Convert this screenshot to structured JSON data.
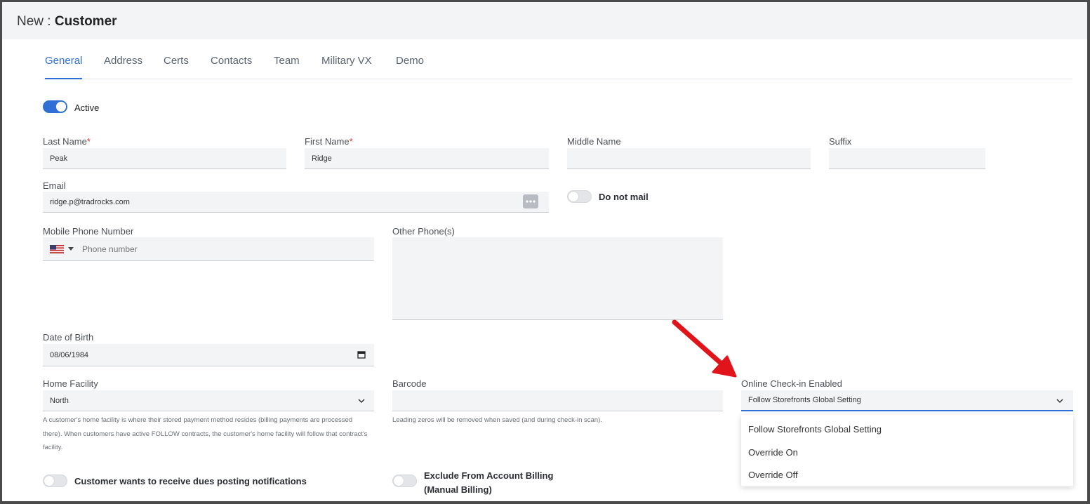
{
  "header": {
    "prefix": "New :",
    "title": "Customer"
  },
  "tabs": [
    "General",
    "Address",
    "Certs",
    "Contacts",
    "Team",
    "Military VX",
    "Demo"
  ],
  "active_toggle": {
    "label": "Active",
    "on": true
  },
  "fields": {
    "last_name": {
      "label": "Last Name",
      "required_mark": "*",
      "value": "Peak"
    },
    "first_name": {
      "label": "First Name",
      "required_mark": "*",
      "value": "Ridge"
    },
    "middle_name": {
      "label": "Middle Name",
      "value": ""
    },
    "suffix": {
      "label": "Suffix",
      "value": ""
    },
    "email": {
      "label": "Email",
      "value": "ridge.p@tradrocks.com"
    },
    "do_not_mail": {
      "label": "Do not mail",
      "on": false
    },
    "mobile_phone": {
      "label": "Mobile Phone Number",
      "placeholder": "Phone number"
    },
    "other_phones": {
      "label": "Other Phone(s)",
      "value": ""
    },
    "dob": {
      "label": "Date of Birth",
      "value": "08/06/1984"
    },
    "home_facility": {
      "label": "Home Facility",
      "value": "North",
      "help": "A customer's home facility is where their stored payment method resides (billing payments are processed there). When customers have active FOLLOW contracts, the customer's home facility will follow that contract's facility."
    },
    "barcode": {
      "label": "Barcode",
      "value": "",
      "help": "Leading zeros will be removed when saved (and during check-in scan)."
    },
    "online_checkin": {
      "label": "Online Check-in Enabled",
      "value": "Follow Storefronts Global Setting",
      "options": [
        "Follow Storefronts Global Setting",
        "Override On",
        "Override Off"
      ]
    }
  },
  "bottom_toggles": {
    "dues_notifications": {
      "label": "Customer wants to receive dues posting notifications",
      "on": false
    },
    "exclude_billing": {
      "label_line1": "Exclude From Account Billing",
      "label_line2": "(Manual Billing)",
      "on": false
    }
  },
  "colors": {
    "accent": "#2f6fd6",
    "arrow": "#e0141a"
  }
}
